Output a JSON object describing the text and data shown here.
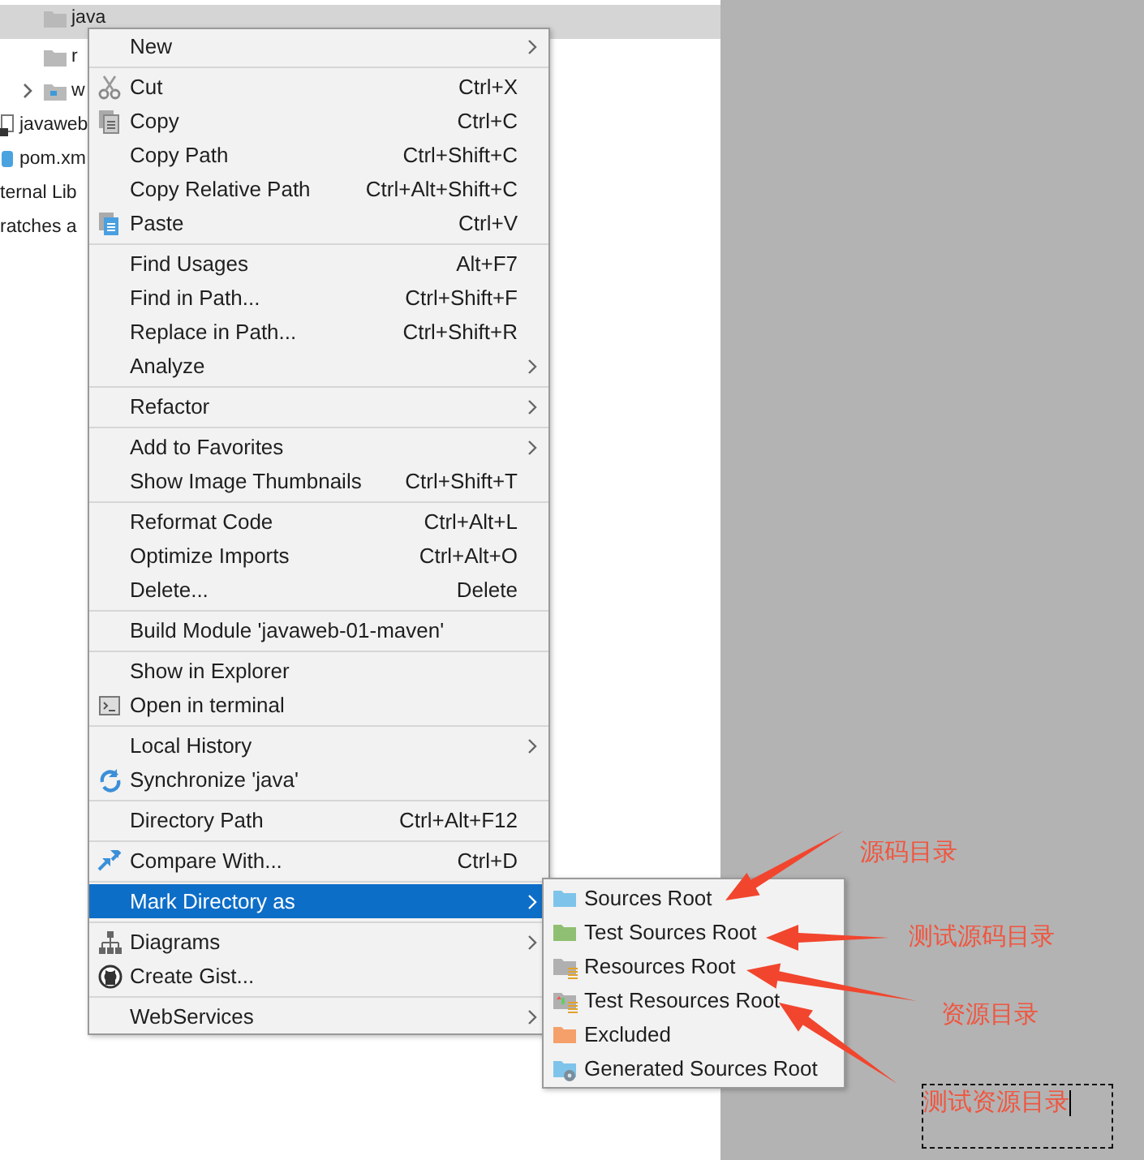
{
  "tree": {
    "nested_items": [
      {
        "label": "java",
        "kind": "folder",
        "selected": true
      },
      {
        "label": "r",
        "kind": "folder",
        "selected": false
      },
      {
        "label": "w",
        "kind": "web-folder",
        "selected": false,
        "expanded": false
      }
    ],
    "items": [
      {
        "label": "javaweb",
        "kind": "module-file",
        "selected": false
      },
      {
        "label": "pom.xm",
        "kind": "maven-file",
        "selected": false
      },
      {
        "label": "ternal Lib",
        "kind": "plain",
        "selected": false
      },
      {
        "label": "ratches a",
        "kind": "plain",
        "selected": false
      }
    ]
  },
  "context_menu": {
    "groups": [
      [
        {
          "label": "New",
          "has_submenu": true,
          "selected": false
        }
      ],
      [
        {
          "label": "Cut",
          "shortcut": "Ctrl+X",
          "has_submenu": false,
          "selected": false,
          "kind": "cut"
        },
        {
          "label": "Copy",
          "shortcut": "Ctrl+C",
          "has_submenu": false,
          "selected": false,
          "kind": "copy"
        },
        {
          "label": "Copy Path",
          "shortcut": "Ctrl+Shift+C",
          "has_submenu": false,
          "selected": false
        },
        {
          "label": "Copy Relative Path",
          "shortcut": "Ctrl+Alt+Shift+C",
          "has_submenu": false,
          "selected": false
        },
        {
          "label": "Paste",
          "shortcut": "Ctrl+V",
          "has_submenu": false,
          "selected": false,
          "kind": "paste"
        }
      ],
      [
        {
          "label": "Find Usages",
          "shortcut": "Alt+F7",
          "has_submenu": false,
          "selected": false
        },
        {
          "label": "Find in Path...",
          "shortcut": "Ctrl+Shift+F",
          "has_submenu": false,
          "selected": false
        },
        {
          "label": "Replace in Path...",
          "shortcut": "Ctrl+Shift+R",
          "has_submenu": false,
          "selected": false
        },
        {
          "label": "Analyze",
          "has_submenu": true,
          "selected": false
        }
      ],
      [
        {
          "label": "Refactor",
          "has_submenu": true,
          "selected": false
        }
      ],
      [
        {
          "label": "Add to Favorites",
          "has_submenu": true,
          "selected": false
        },
        {
          "label": "Show Image Thumbnails",
          "shortcut": "Ctrl+Shift+T",
          "has_submenu": false,
          "selected": false
        }
      ],
      [
        {
          "label": "Reformat Code",
          "shortcut": "Ctrl+Alt+L",
          "has_submenu": false,
          "selected": false
        },
        {
          "label": "Optimize Imports",
          "shortcut": "Ctrl+Alt+O",
          "has_submenu": false,
          "selected": false
        },
        {
          "label": "Delete...",
          "shortcut": "Delete",
          "has_submenu": false,
          "selected": false
        }
      ],
      [
        {
          "label": "Build Module 'javaweb-01-maven'",
          "has_submenu": false,
          "selected": false
        }
      ],
      [
        {
          "label": "Show in Explorer",
          "has_submenu": false,
          "selected": false
        },
        {
          "label": "Open in terminal",
          "has_submenu": false,
          "selected": false,
          "kind": "terminal"
        }
      ],
      [
        {
          "label": "Local History",
          "has_submenu": true,
          "selected": false
        },
        {
          "label": "Synchronize 'java'",
          "has_submenu": false,
          "selected": false,
          "kind": "sync"
        }
      ],
      [
        {
          "label": "Directory Path",
          "shortcut": "Ctrl+Alt+F12",
          "has_submenu": false,
          "selected": false
        }
      ],
      [
        {
          "label": "Compare With...",
          "shortcut": "Ctrl+D",
          "has_submenu": false,
          "selected": false,
          "kind": "compare"
        }
      ],
      [
        {
          "label": "Mark Directory as",
          "has_submenu": true,
          "selected": true
        }
      ],
      [
        {
          "label": "Diagrams",
          "has_submenu": true,
          "selected": false,
          "kind": "diagram"
        },
        {
          "label": "Create Gist...",
          "has_submenu": false,
          "selected": false,
          "kind": "gist"
        }
      ],
      [
        {
          "label": "WebServices",
          "has_submenu": true,
          "selected": false
        }
      ]
    ]
  },
  "submenu": {
    "items": [
      {
        "label": "Sources Root",
        "kind": "sources",
        "selected": false
      },
      {
        "label": "Test Sources Root",
        "kind": "test-sources",
        "selected": false
      },
      {
        "label": "Resources Root",
        "kind": "resources",
        "selected": false
      },
      {
        "label": "Test Resources Root",
        "kind": "test-resources",
        "selected": false
      },
      {
        "label": "Excluded",
        "kind": "excluded",
        "selected": false
      },
      {
        "label": "Generated Sources Root",
        "kind": "generated",
        "selected": false
      }
    ]
  },
  "annotations": [
    {
      "text": "源码目录",
      "kind": "label"
    },
    {
      "text": "测试源码目录",
      "kind": "label"
    },
    {
      "text": "资源目录",
      "kind": "label"
    },
    {
      "text": "测试资源目录",
      "kind": "text-field"
    }
  ]
}
